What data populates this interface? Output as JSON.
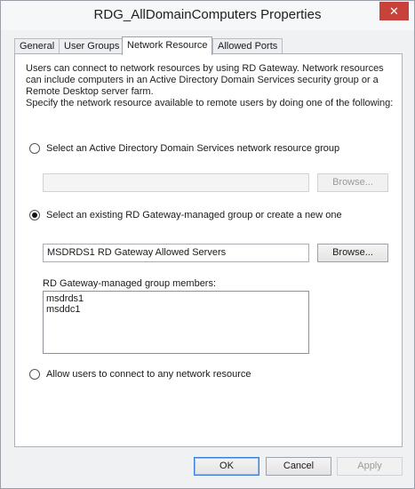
{
  "window": {
    "title": "RDG_AllDomainComputers Properties",
    "close_glyph": "✕"
  },
  "tabs": [
    {
      "label": "General"
    },
    {
      "label": "User Groups"
    },
    {
      "label": "Network Resource"
    },
    {
      "label": "Allowed Ports"
    }
  ],
  "panel": {
    "description": [
      "Users can connect to network resources by using RD Gateway. Network resources",
      "can include computers in an Active Directory Domain Services security group or a",
      "Remote Desktop server farm.",
      "Specify the network resource available to remote users by doing one of the following:"
    ],
    "option_ad": {
      "label": "Select an Active Directory Domain Services network resource group",
      "checked": false
    },
    "ad_group_value": "",
    "ad_browse_label": "Browse...",
    "option_rdg": {
      "label": "Select an existing RD Gateway-managed group or create a new one",
      "checked": true
    },
    "rdg_group_value": "MSDRDS1 RD Gateway Allowed Servers",
    "rdg_browse_label": "Browse...",
    "members_label": "RD Gateway-managed group members:",
    "members": [
      "msdrds1",
      "msddc1"
    ],
    "option_any": {
      "label": "Allow users to connect to any network resource",
      "checked": false
    }
  },
  "footer": {
    "ok_label": "OK",
    "cancel_label": "Cancel",
    "apply_label": "Apply"
  }
}
